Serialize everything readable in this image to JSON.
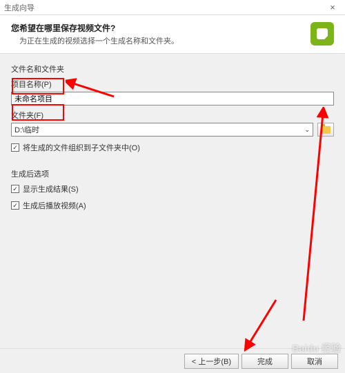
{
  "titlebar": {
    "title": "生成向导"
  },
  "header": {
    "title": "您希望在哪里保存视频文件?",
    "subtitle": "为正在生成的视频选择一个生成名称和文件夹。"
  },
  "fileSection": {
    "title": "文件名和文件夹",
    "projectNameLabel": "项目名称(P)",
    "projectNameValue": "未命名项目",
    "folderLabel": "文件夹(F)",
    "folderValue": "D:\\临时",
    "organizeLabel": "将生成的文件组织到子文件夹中(O)"
  },
  "postSection": {
    "title": "生成后选项",
    "showResultLabel": "显示生成结果(S)",
    "playAfterLabel": "生成后播放视频(A)"
  },
  "buttons": {
    "back": "< 上一步(B)",
    "finish": "完成",
    "cancel": "取消"
  },
  "watermark": "Baidu 经验"
}
